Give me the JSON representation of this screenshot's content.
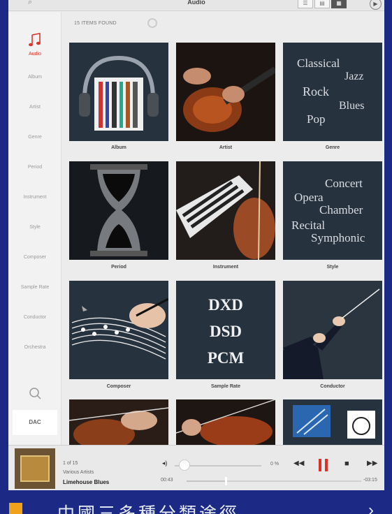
{
  "topbar": {
    "title": "Audio",
    "back_icon": "search-icon",
    "views": [
      "list",
      "detail",
      "grid"
    ],
    "active_view": "grid"
  },
  "sidebar": {
    "items": [
      {
        "label": "Audio",
        "active": true
      },
      {
        "label": "Album"
      },
      {
        "label": "Artist"
      },
      {
        "label": "Genre"
      },
      {
        "label": "Period"
      },
      {
        "label": "Instrument"
      },
      {
        "label": "Style"
      },
      {
        "label": "Composer"
      },
      {
        "label": "Sample Rate"
      },
      {
        "label": "Conductor"
      },
      {
        "label": "Orchestra"
      }
    ],
    "dac_label": "DAC"
  },
  "main": {
    "count_text": "15 ITEMS FOUND",
    "tiles": [
      {
        "label": "Album"
      },
      {
        "label": "Artist"
      },
      {
        "label": "Genre",
        "words": [
          "Classical",
          "Jazz",
          "Rock",
          "Blues",
          "Pop"
        ]
      },
      {
        "label": "Period"
      },
      {
        "label": "Instrument"
      },
      {
        "label": "Style",
        "words": [
          "Concert",
          "Opera",
          "Chamber",
          "Recital",
          "Symphonic"
        ]
      },
      {
        "label": "Composer"
      },
      {
        "label": "Sample Rate",
        "words": [
          "DXD",
          "DSD",
          "PCM"
        ]
      },
      {
        "label": "Conductor"
      }
    ]
  },
  "player": {
    "position": "1 of 15",
    "artist": "Various Artists",
    "track": "Limehouse Blues",
    "elapsed": "00:43",
    "remaining": "-03:15",
    "volume_label": "0 %",
    "progress": 0.22
  },
  "caption": {
    "text": "中國三多種分類途徑",
    "arrow": "›"
  },
  "colors": {
    "accent": "#d9362a",
    "frame": "#1c2a86",
    "tile_bg": "#27323f"
  }
}
